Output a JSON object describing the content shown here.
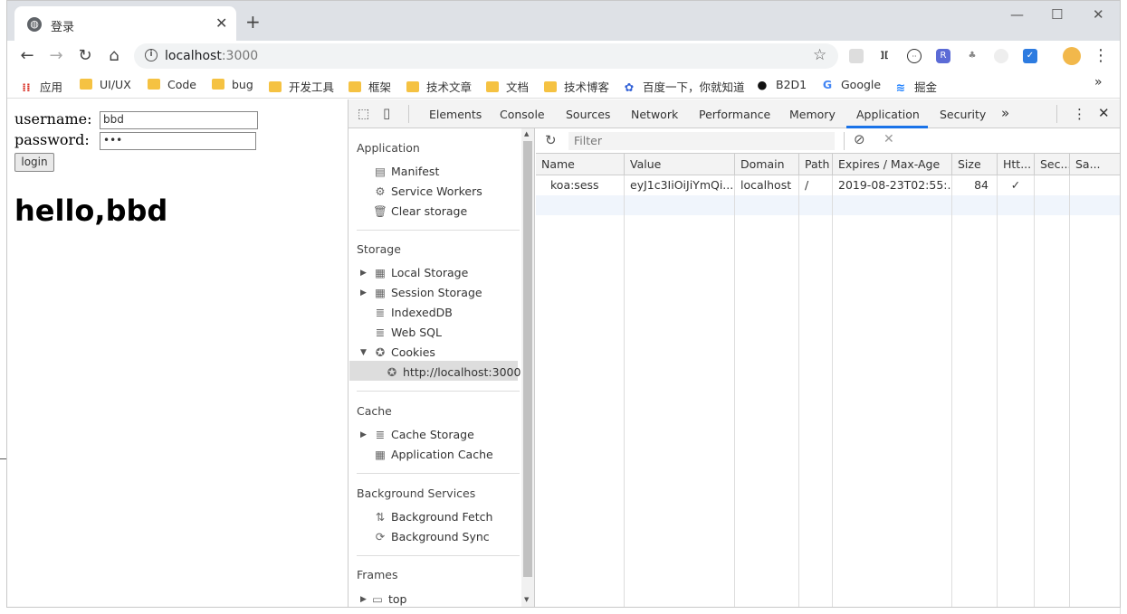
{
  "browser": {
    "tab_title": "登录",
    "tab_favicon": "globe-icon",
    "url_host": "localhost",
    "url_port": ":3000"
  },
  "bookmarks": [
    {
      "label": "应用",
      "icon": "apps-grid-icon"
    },
    {
      "label": "UI/UX",
      "icon": "folder-icon"
    },
    {
      "label": "Code",
      "icon": "folder-icon"
    },
    {
      "label": "bug",
      "icon": "folder-icon"
    },
    {
      "label": "开发工具",
      "icon": "folder-icon"
    },
    {
      "label": "框架",
      "icon": "folder-icon"
    },
    {
      "label": "技术文章",
      "icon": "folder-icon"
    },
    {
      "label": "文档",
      "icon": "folder-icon"
    },
    {
      "label": "技术博客",
      "icon": "folder-icon"
    },
    {
      "label": "百度一下，你就知道",
      "icon": "baidu-icon"
    },
    {
      "label": "B2D1",
      "icon": "github-icon"
    },
    {
      "label": "Google",
      "icon": "google-icon"
    },
    {
      "label": "掘金",
      "icon": "juejin-icon"
    }
  ],
  "page": {
    "username_label": "username:",
    "username_value": "bbd",
    "password_label": "password:",
    "password_value": "•••",
    "login_label": "login",
    "greeting": "hello,bbd"
  },
  "devtools": {
    "tabs": [
      "Elements",
      "Console",
      "Sources",
      "Network",
      "Performance",
      "Memory",
      "Application",
      "Security"
    ],
    "active_tab": "Application",
    "more": "»",
    "sidebar": {
      "application_header": "Application",
      "application_items": [
        "Manifest",
        "Service Workers",
        "Clear storage"
      ],
      "storage_header": "Storage",
      "storage_items": [
        "Local Storage",
        "Session Storage",
        "IndexedDB",
        "Web SQL",
        "Cookies"
      ],
      "cookie_origin": "http://localhost:3000",
      "cache_header": "Cache",
      "cache_items": [
        "Cache Storage",
        "Application Cache"
      ],
      "bg_header": "Background Services",
      "bg_items": [
        "Background Fetch",
        "Background Sync"
      ],
      "frames_header": "Frames",
      "frames_items": [
        "top"
      ]
    },
    "filter_placeholder": "Filter",
    "columns": [
      "Name",
      "Value",
      "Domain",
      "Path",
      "Expires / Max-Age",
      "Size",
      "Htt...",
      "Sec...",
      "Sa..."
    ],
    "rows": [
      [
        "koa:sess",
        "eyJ1c3IiOiJiYmQi...",
        "localhost",
        "/",
        "2019-08-23T02:55:...",
        "84",
        "✓",
        "",
        ""
      ]
    ]
  }
}
